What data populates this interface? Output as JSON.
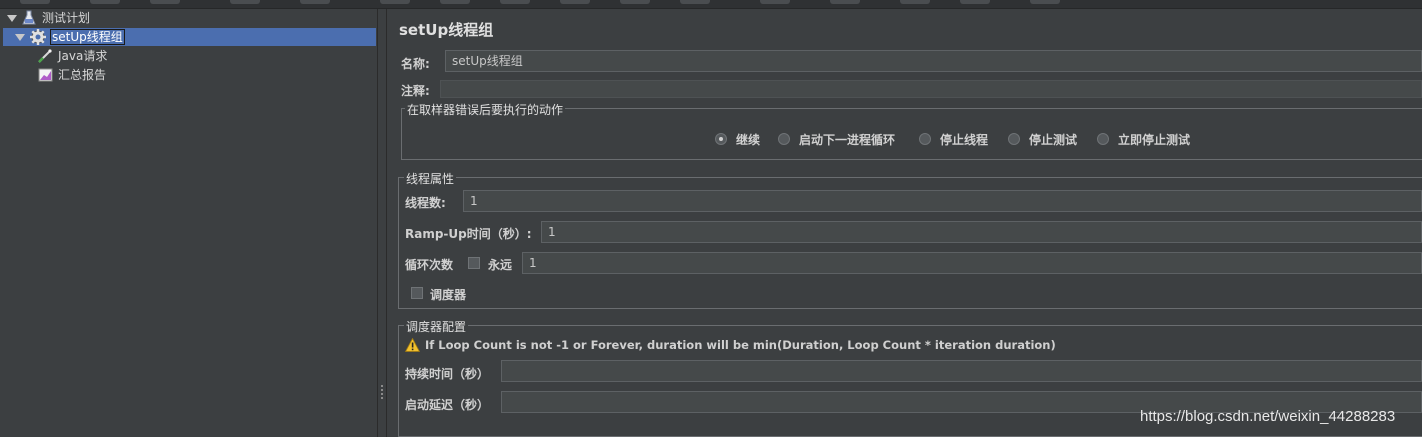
{
  "tree": {
    "items": [
      {
        "label": "测试计划",
        "icon": "test-plan-icon"
      },
      {
        "label": "setUp线程组",
        "icon": "gear-icon"
      },
      {
        "label": "Java请求",
        "icon": "sampler-icon"
      },
      {
        "label": "汇总报告",
        "icon": "report-icon"
      }
    ]
  },
  "panel": {
    "title": "setUp线程组",
    "name_label": "名称:",
    "name_value": "setUp线程组",
    "comment_label": "注释:",
    "comment_value": ""
  },
  "error_action": {
    "title": "在取样器错误后要执行的动作",
    "options": [
      "继续",
      "启动下一进程循环",
      "停止线程",
      "停止测试",
      "立即停止测试"
    ],
    "selected": "继续"
  },
  "thread_props": {
    "title": "线程属性",
    "threads_label": "线程数:",
    "threads_value": "1",
    "rampup_label": "Ramp-Up时间（秒）:",
    "rampup_value": "1",
    "loop_label": "循环次数",
    "forever_label": "永远",
    "forever_checked": false,
    "loop_value": "1",
    "scheduler_label": "调度器",
    "scheduler_checked": false
  },
  "scheduler_config": {
    "title": "调度器配置",
    "warning": "If Loop Count is not -1 or Forever, duration will be min(Duration, Loop Count * iteration duration)",
    "duration_label": "持续时间（秒）",
    "duration_value": "",
    "delay_label": "启动延迟（秒）",
    "delay_value": ""
  },
  "watermark": "https://blog.csdn.net/weixin_44288283",
  "colors": {
    "background": "#3c3f41",
    "selection": "#4b6eaf",
    "warning": "#f2c12e"
  }
}
